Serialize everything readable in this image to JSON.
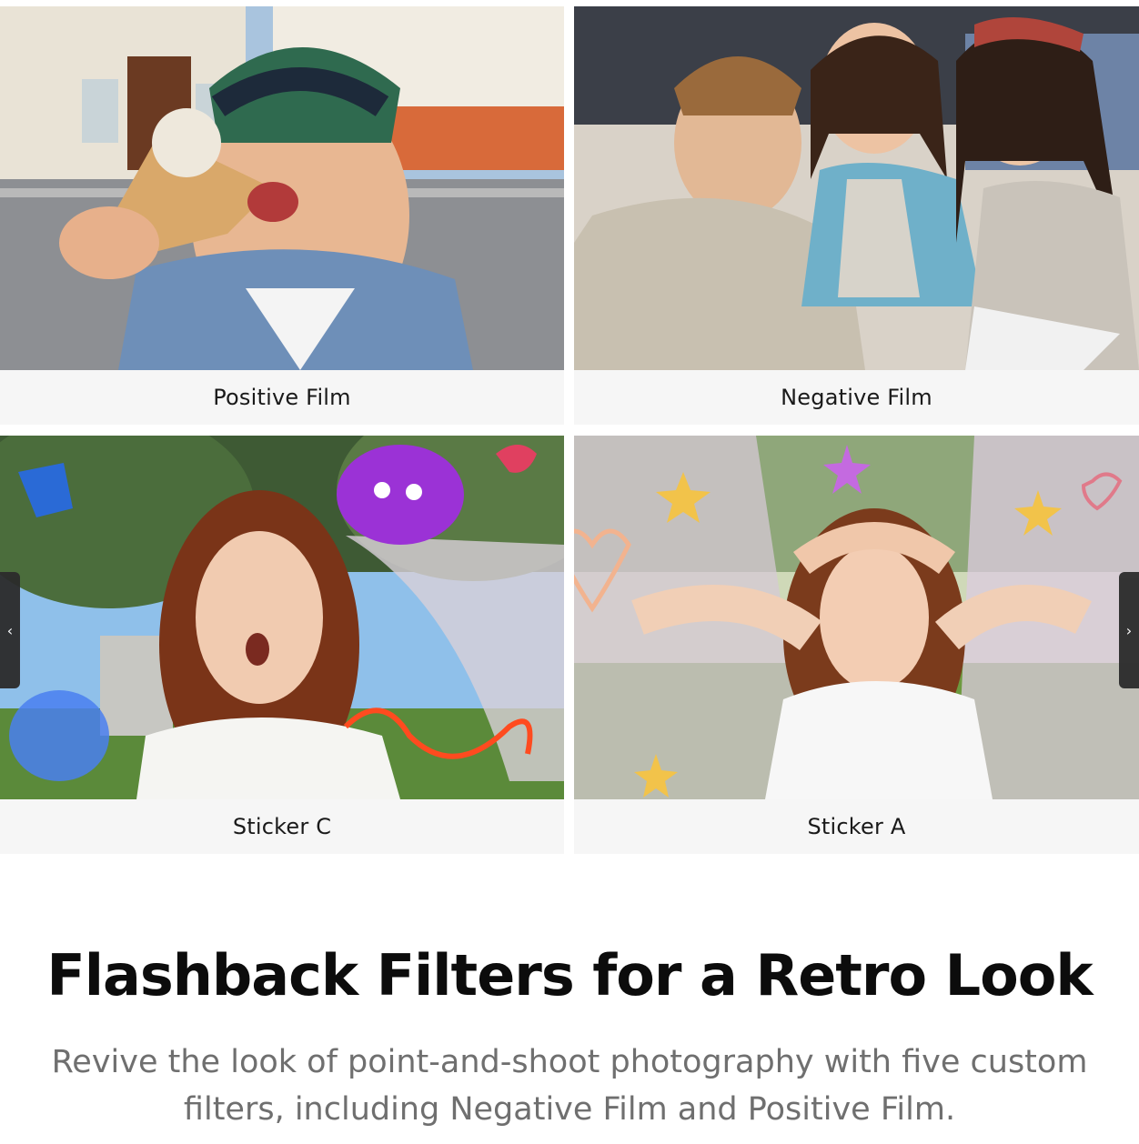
{
  "gallery": {
    "cards": [
      {
        "label": "Positive Film",
        "image": "boy eating ice cream on street"
      },
      {
        "label": "Negative Film",
        "image": "three friends selfie"
      },
      {
        "label": "Sticker C",
        "image": "surprised girl with doodle stickers"
      },
      {
        "label": "Sticker A",
        "image": "smiling girl with star and heart stickers"
      }
    ],
    "prev_icon": "chevron-left-icon",
    "next_icon": "chevron-right-icon"
  },
  "headline": "Flashback Filters for a Retro Look",
  "subtext": "Revive the look of point-and-shoot photography with five custom filters, including Negative Film and Positive Film.",
  "colors": {
    "caption_bg": "#f6f6f6",
    "headline": "#0c0c0c",
    "subtext": "#6f6f6f",
    "nav_bg": "#2b2b2b"
  }
}
